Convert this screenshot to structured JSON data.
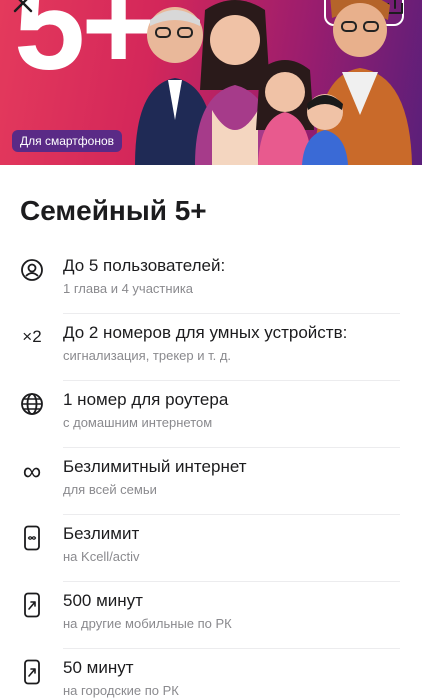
{
  "banner": {
    "big_text": "5+",
    "badge": "Для смартфонов",
    "colors": {
      "from": "#e43a5c",
      "to": "#5a1f7a",
      "badge": "#5a2a86"
    }
  },
  "tariff": {
    "title": "Семейный 5+"
  },
  "features": [
    {
      "icon": "users-circle-icon",
      "title": "До 5 пользователей:",
      "subtitle": "1 глава и 4 участника"
    },
    {
      "icon": "x2-icon",
      "icon_text": "×2",
      "title": "До 2 номеров для умных устройств:",
      "subtitle": "сигнализация, трекер и т. д."
    },
    {
      "icon": "globe-icon",
      "title": "1 номер для роутера",
      "subtitle": "с домашним интернетом"
    },
    {
      "icon": "infinity-icon",
      "icon_text": "∞",
      "title": "Безлимитный интернет",
      "subtitle": "для всей семьи"
    },
    {
      "icon": "phone-infinity-icon",
      "title": "Безлимит",
      "subtitle": "на Kcell/activ"
    },
    {
      "icon": "phone-outgoing-icon",
      "title": "500 минут",
      "subtitle": "на другие мобильные по РК"
    },
    {
      "icon": "phone-outgoing-icon",
      "title": "50 минут",
      "subtitle": "на городские по РК"
    }
  ]
}
